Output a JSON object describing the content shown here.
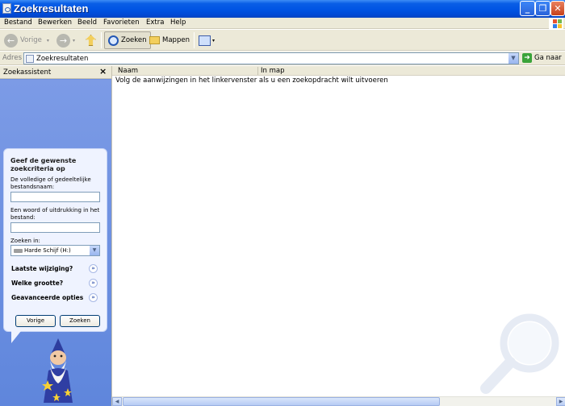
{
  "window": {
    "title": "Zoekresultaten",
    "minimize": "_",
    "maximize": "❐",
    "close": "✕"
  },
  "menu": [
    "Bestand",
    "Bewerken",
    "Beeld",
    "Favorieten",
    "Extra",
    "Help"
  ],
  "toolbar": {
    "back": "Vorige",
    "search": "Zoeken",
    "folders": "Mappen"
  },
  "address": {
    "label": "Adres",
    "value": "Zoekresultaten",
    "go": "Ga naar"
  },
  "search_pane": {
    "title": "Zoekassistent",
    "close": "×",
    "heading": "Geef de gewenste zoekcriteria op",
    "filename_label": "De volledige of gedeeltelijke bestandsnaam:",
    "filename_value": "",
    "phrase_label": "Een woord of uitdrukking in het bestand:",
    "phrase_value": "",
    "look_in_label": "Zoeken in:",
    "look_in_value": "Harde Schijf (H:)",
    "options": [
      "Laatste wijziging?",
      "Welke grootte?",
      "Geavanceerde opties"
    ],
    "back_button": "Vorige",
    "search_button": "Zoeken"
  },
  "results": {
    "columns": [
      "Naam",
      "In map"
    ],
    "message": "Volg de aanwijzingen in het linkervenster als u een zoekopdracht wilt uitvoeren"
  },
  "colors": {
    "title_bar": "#0054e3",
    "pane_blue": "#6e8fe0",
    "chrome": "#ece9d8"
  }
}
